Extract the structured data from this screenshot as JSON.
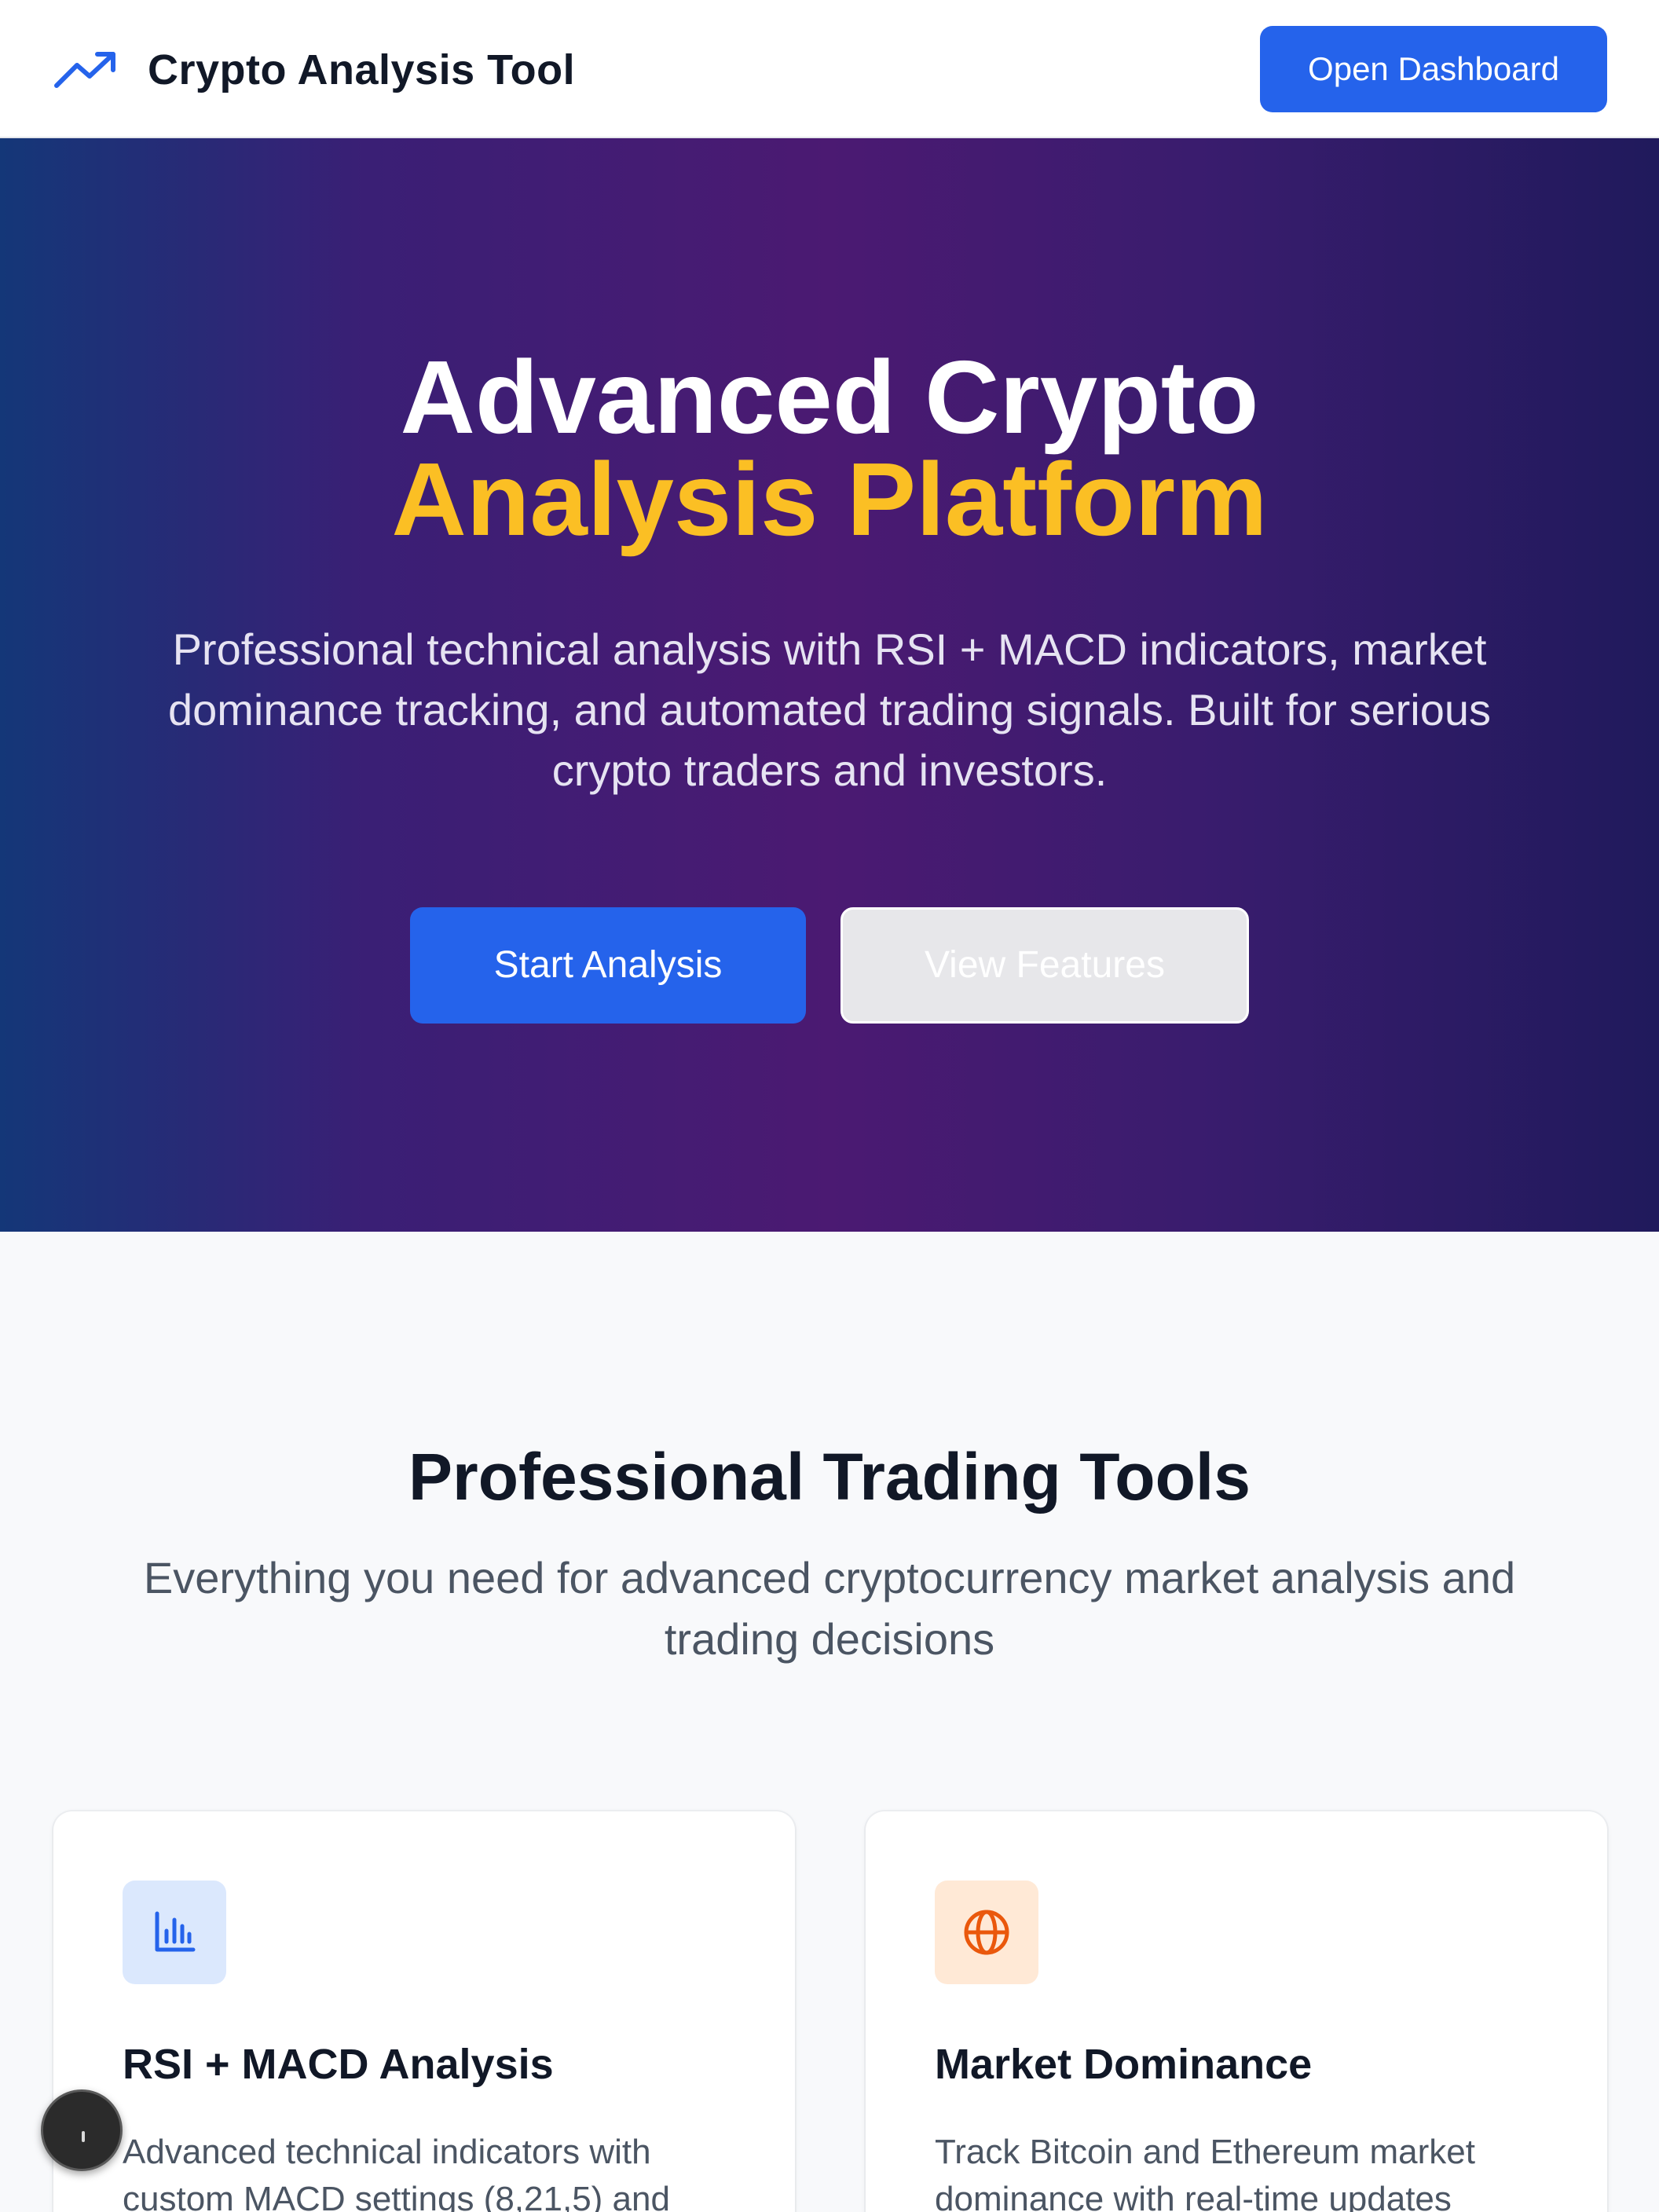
{
  "header": {
    "brand_icon": "trending-up-icon",
    "title": "Crypto Analysis Tool",
    "dashboard_button": "Open Dashboard"
  },
  "hero": {
    "title_line1": "Advanced Crypto",
    "title_line2": "Analysis Platform",
    "description": "Professional technical analysis with RSI + MACD indicators, market dominance tracking, and automated trading signals. Built for serious crypto traders and investors.",
    "primary_button": "Start Analysis",
    "secondary_button": "View Features"
  },
  "tools": {
    "title": "Professional Trading Tools",
    "subtitle": "Everything you need for advanced cryptocurrency market analysis and trading decisions",
    "cards": [
      {
        "icon": "bar-chart-icon",
        "title": "RSI + MACD Analysis",
        "description": "Advanced technical indicators with custom MACD settings (8,21,5) and"
      },
      {
        "icon": "globe-icon",
        "title": "Market Dominance",
        "description": "Track Bitcoin and Ethereum market dominance with real-time updates"
      }
    ]
  },
  "colors": {
    "brand_blue": "#2563eb",
    "highlight_yellow": "#fbbf24",
    "hero_gradient_start": "#143778",
    "hero_gradient_mid": "#4b1a72",
    "hero_gradient_end": "#201a5c",
    "card_icon_blue_bg": "#dbe8fd",
    "card_icon_orange_bg": "#ffe9d6",
    "orange_icon": "#ea580c"
  }
}
